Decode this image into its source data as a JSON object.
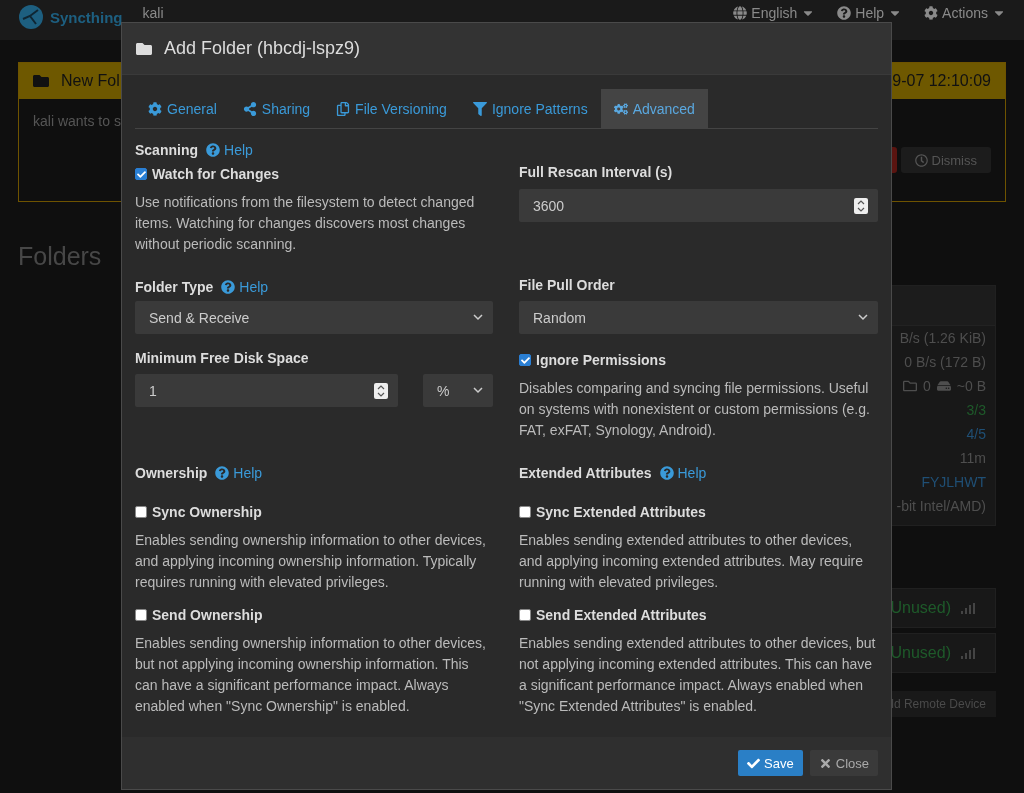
{
  "navbar": {
    "brand": "Syncthing",
    "device": "kali",
    "menus": [
      {
        "label": "English"
      },
      {
        "label": "Help"
      },
      {
        "label": "Actions"
      }
    ]
  },
  "notification": {
    "title": "New Fol",
    "time": "9-07 12:10:09",
    "text": "kali wants to s",
    "dismiss": "Dismiss"
  },
  "folders_heading": "Folders",
  "device_panel": {
    "rows": [
      {
        "kind": "text",
        "value": "B/s (1.26 KiB)"
      },
      {
        "kind": "text",
        "value": "0 B/s (172 B)"
      },
      {
        "kind": "counts",
        "folders": "0",
        "size": "~0 B"
      },
      {
        "kind": "ok",
        "value": "3/3"
      },
      {
        "kind": "link",
        "value": "4/5"
      },
      {
        "kind": "text",
        "value": "11m"
      },
      {
        "kind": "link",
        "value": "FYJLHWT"
      },
      {
        "kind": "text",
        "value": "-bit Intel/AMD)"
      }
    ]
  },
  "remote_devices": [
    {
      "status": "Unused)"
    },
    {
      "status": "Unused)"
    }
  ],
  "add_device_button": "ld Remote Device",
  "dialog": {
    "title": "Add Folder (hbcdj-lspz9)",
    "tabs": [
      {
        "label": "General",
        "selected": false
      },
      {
        "label": "Sharing",
        "selected": false
      },
      {
        "label": "File Versioning",
        "selected": false
      },
      {
        "label": "Ignore Patterns",
        "selected": false
      },
      {
        "label": "Advanced",
        "selected": true
      }
    ],
    "scanning": {
      "heading": "Scanning",
      "help": "Help",
      "label": "Watch for Changes",
      "checked": true,
      "description": "Use notifications from the filesystem to detect changed items. Watching for changes discovers most changes without periodic scanning."
    },
    "rescan": {
      "label": "Full Rescan Interval (s)",
      "value": "3600"
    },
    "folder_type": {
      "heading": "Folder Type",
      "help": "Help",
      "value": "Send & Receive"
    },
    "pull_order": {
      "label": "File Pull Order",
      "value": "Random"
    },
    "min_disk": {
      "label": "Minimum Free Disk Space",
      "value": "1",
      "unit": "%"
    },
    "ignore_permissions": {
      "label": "Ignore Permissions",
      "checked": true,
      "description": "Disables comparing and syncing file permissions. Useful on systems with nonexistent or custom permissions (e.g. FAT, exFAT, Synology, Android)."
    },
    "ownership": {
      "heading": "Ownership",
      "help": "Help",
      "options": [
        {
          "label": "Sync Ownership",
          "checked": false,
          "description": "Enables sending ownership information to other devices, and applying incoming ownership information. Typically requires running with elevated privileges."
        },
        {
          "label": "Send Ownership",
          "checked": false,
          "description": "Enables sending ownership information to other devices, but not applying incoming ownership information. This can have a significant performance impact. Always enabled when \"Sync Ownership\" is enabled."
        }
      ]
    },
    "extended_attributes": {
      "heading": "Extended Attributes",
      "help": "Help",
      "options": [
        {
          "label": "Sync Extended Attributes",
          "checked": false,
          "description": "Enables sending extended attributes to other devices, and applying incoming extended attributes. May require running with elevated privileges."
        },
        {
          "label": "Send Extended Attributes",
          "checked": false,
          "description": "Enables sending extended attributes to other devices, but not applying incoming extended attributes. This can have a significant performance impact. Always enabled when \"Sync Extended Attributes\" is enabled."
        }
      ]
    },
    "buttons": {
      "save": "Save",
      "close": "Close"
    }
  }
}
